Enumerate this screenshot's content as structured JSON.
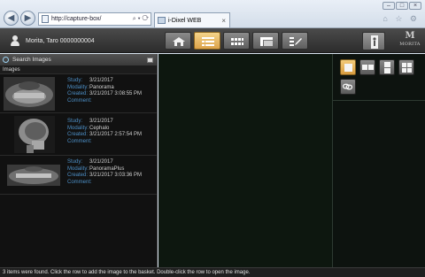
{
  "browser": {
    "address": "http://capture-box/",
    "address_tools": "⌕ ▾ ⟳",
    "tab_title": "i-Dixel WEB",
    "tab_close": "×",
    "back_glyph": "◀",
    "forward_glyph": "▶",
    "window_buttons": [
      "–",
      "□",
      "×"
    ],
    "right_icons": "⌂ ☆ ⚙"
  },
  "header": {
    "user": "Morita, Taro  0000000004",
    "logo_mark": "M",
    "logo_text": "MORITA",
    "toolbar": [
      {
        "name": "home-button",
        "icon": "home-icon",
        "active": false
      },
      {
        "name": "list-view-button",
        "icon": "list-grid-icon",
        "active": true
      },
      {
        "name": "thumbnail-view-button",
        "icon": "thumbnail-strip-icon",
        "active": false
      },
      {
        "name": "image-view-button",
        "icon": "image-viewer-icon",
        "active": false
      },
      {
        "name": "report-button",
        "icon": "pencil-report-icon",
        "active": false
      }
    ]
  },
  "left_panel": {
    "search_label": "Search Images",
    "images_label": "Images",
    "items": [
      {
        "study_k": "Study:",
        "study": "3/21/2017",
        "modality_k": "Modality:",
        "modality": "Panorama",
        "created_k": "Created:",
        "created": "3/21/2017 3:08:55 PM",
        "comment_k": "Comment:",
        "comment": ""
      },
      {
        "study_k": "Study:",
        "study": "3/21/2017",
        "modality_k": "Modality:",
        "modality": "Cephalo",
        "created_k": "Created:",
        "created": "3/21/2017 2:57:54 PM",
        "comment_k": "Comment:",
        "comment": ""
      },
      {
        "study_k": "Study:",
        "study": "3/21/2017",
        "modality_k": "Modality:",
        "modality": "PanoramaPlus",
        "created_k": "Created:",
        "created": "3/21/2017 3:03:36 PM",
        "comment_k": "Comment:",
        "comment": ""
      }
    ]
  },
  "right_panel": {
    "layout_buttons": [
      "layout-1x1-button",
      "layout-2x1-button",
      "layout-1x2-button",
      "layout-2x2-button"
    ],
    "link_button": "link-icon"
  },
  "status": "3 items were found. Click the row to add the image to the basket. Double-click the row to open the image.",
  "colors": {
    "accent": "#e0a948",
    "meta_key": "#4d8fc6",
    "background": "#0d170f"
  }
}
